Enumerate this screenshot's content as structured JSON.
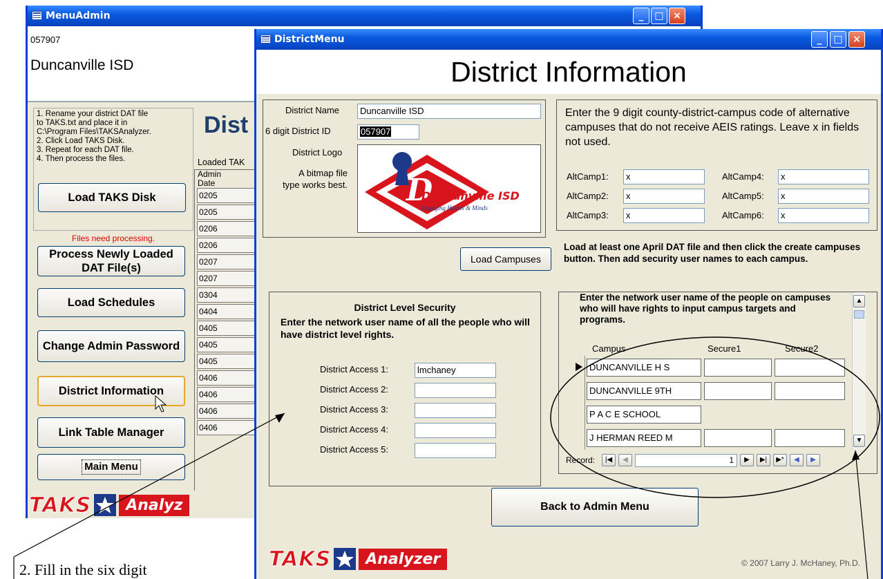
{
  "menu_admin": {
    "title": "MenuAdmin",
    "district_id": "057907",
    "district_name": "Duncanville ISD",
    "instructions": [
      "1. Rename your district DAT file",
      "to TAKS.txt and place it in",
      "C:\\Program Files\\TAKSAnalyzer.",
      "2. Click Load TAKS Disk.",
      "3. Repeat for each DAT file.",
      "4. Then process the files."
    ],
    "buttons": {
      "load_taks": "Load TAKS Disk",
      "process": "Process Newly Loaded DAT File(s)",
      "load_schedules": "Load Schedules",
      "change_password": "Change Admin Password",
      "district_info": "District Information",
      "link_table": "Link Table Manager",
      "main_menu": "Main Menu"
    },
    "warning": "Files need processing.",
    "heading_partial": "Dist",
    "loaded_label": "Loaded TAK",
    "admin_header": "Admin Date",
    "admin_dates": [
      "0205",
      "0205",
      "0206",
      "0206",
      "0207",
      "0207",
      "0304",
      "0404",
      "0405",
      "0405",
      "0405",
      "0406",
      "0406",
      "0406",
      "0406"
    ]
  },
  "district_menu": {
    "title": "DistrictMenu",
    "heading": "District Information",
    "district_name_label": "District Name",
    "district_name_value": "Duncanville ISD",
    "district_id_label": "6 digit District ID",
    "district_id_value": "057907",
    "logo_label": "District Logo",
    "logo_hint": "A bitmap file type works best.",
    "logo_text": "Duncanville ISD",
    "logo_tagline": "Engaging Hearts & Minds",
    "alt_intro": "Enter the 9 digit county-district-campus code of alternative campuses that do not receive AEIS ratings. Leave x in fields not used.",
    "alt_campuses": [
      {
        "label": "AltCamp1:",
        "value": "x"
      },
      {
        "label": "AltCamp2:",
        "value": "x"
      },
      {
        "label": "AltCamp3:",
        "value": "x"
      },
      {
        "label": "AltCamp4:",
        "value": "x"
      },
      {
        "label": "AltCamp5:",
        "value": "x"
      },
      {
        "label": "AltCamp6:",
        "value": "x"
      }
    ],
    "load_campuses_button": "Load Campuses",
    "load_campuses_note": "Load at least one April DAT file and then click the create campuses button. Then add security user names to each campus.",
    "security_title": "District Level Security",
    "security_intro": "Enter the network user name of all the people who will have district level rights.",
    "access": [
      {
        "label": "District Access 1:",
        "value": "lmchaney"
      },
      {
        "label": "District Access 2:",
        "value": ""
      },
      {
        "label": "District Access 3:",
        "value": ""
      },
      {
        "label": "District Access 4:",
        "value": ""
      },
      {
        "label": "District Access 5:",
        "value": ""
      }
    ],
    "campus_intro": "Enter the network user name of the people on campuses who will have rights to input campus targets and programs.",
    "campus_headers": [
      "Campus",
      "Secure1",
      "Secure2"
    ],
    "campus_rows": [
      "DUNCANVILLE H S",
      "DUNCANVILLE 9TH",
      "P A C E SCHOOL",
      "J HERMAN REED M"
    ],
    "record_label": "Record:",
    "record_value": "1",
    "back_button": "Back to Admin Menu",
    "copyright": "© 2007 Larry J. McHaney, Ph.D."
  },
  "logo": {
    "taks": "TAKS",
    "analyzer": "Analyzer",
    "analyzer_partial": "Analyz"
  },
  "caption": "2.  Fill in the six digit"
}
